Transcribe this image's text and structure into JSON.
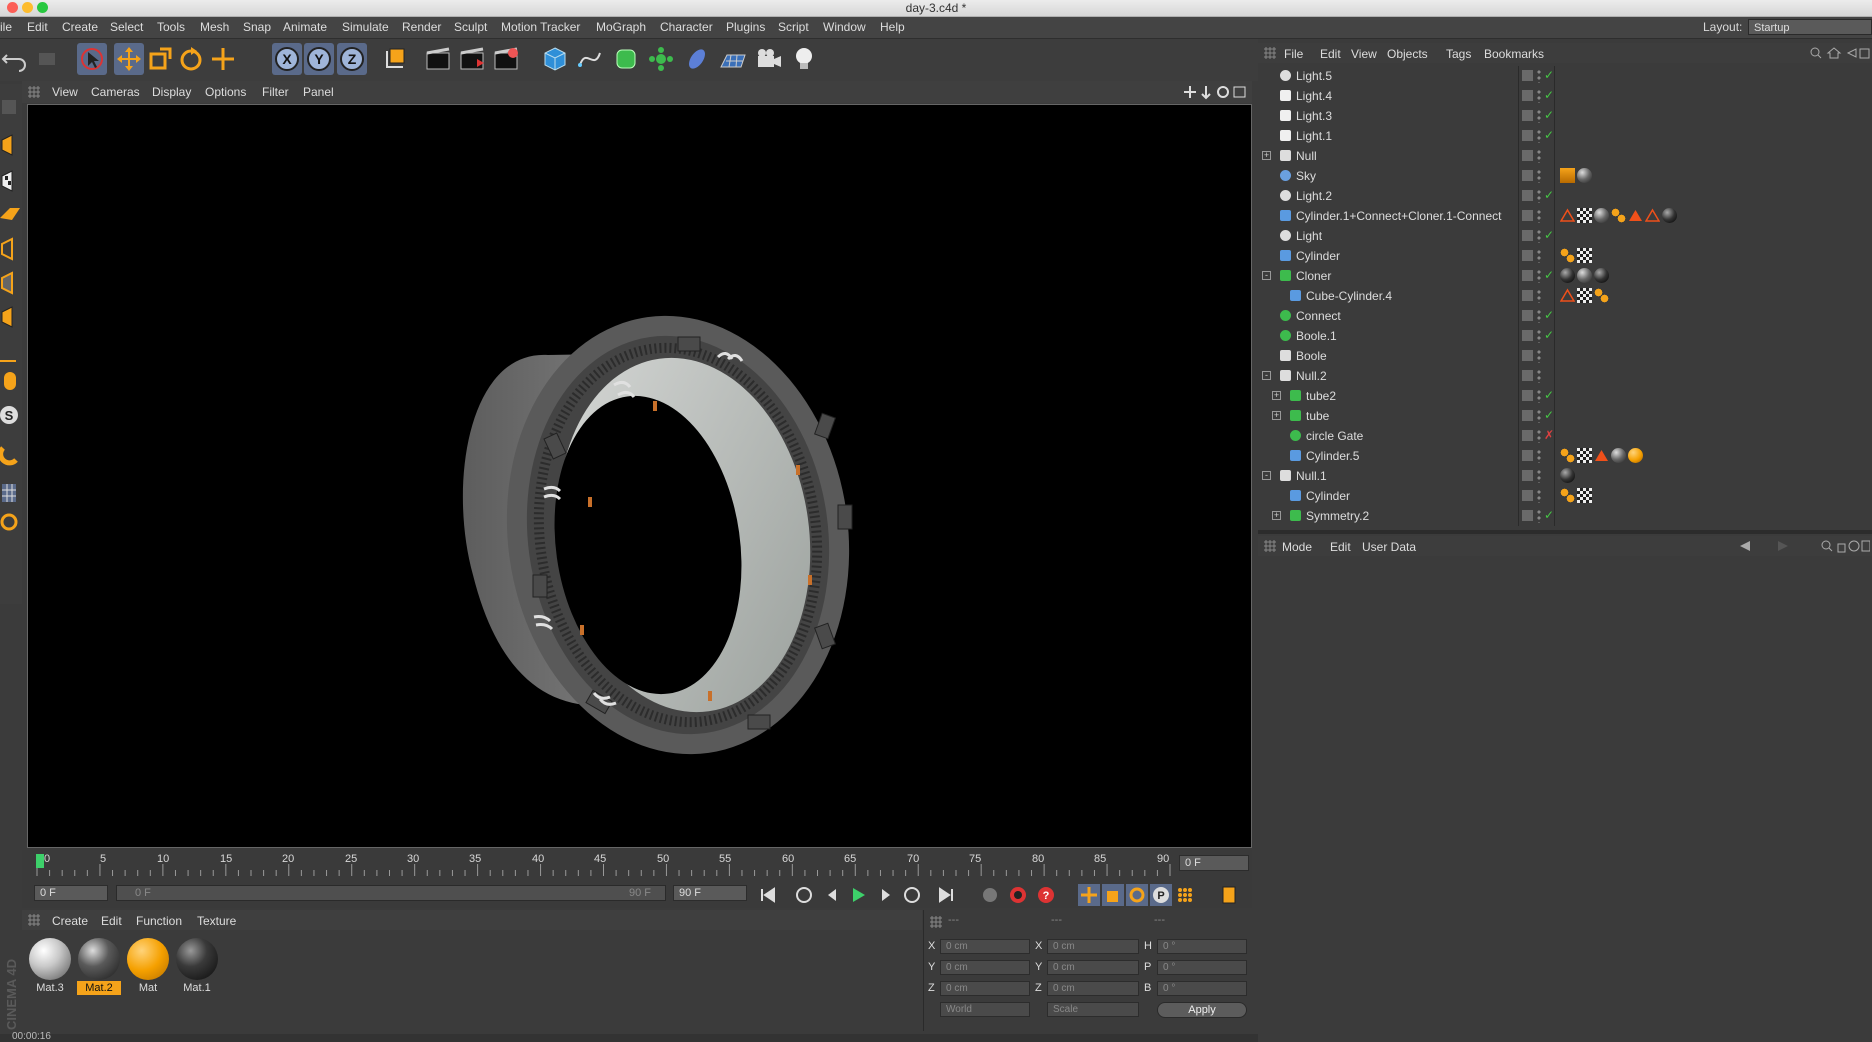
{
  "window": {
    "title": "day-3.c4d *"
  },
  "menubar": {
    "items": [
      "ile",
      "Edit",
      "Create",
      "Select",
      "Tools",
      "Mesh",
      "Snap",
      "Animate",
      "Simulate",
      "Render",
      "Sculpt",
      "Motion Tracker",
      "MoGraph",
      "Character",
      "Plugins",
      "Script",
      "Window",
      "Help"
    ],
    "layout_label": "Layout:",
    "layout_value": "Startup"
  },
  "viewport": {
    "menu": [
      "View",
      "Cameras",
      "Display",
      "Options",
      "Filter",
      "Panel"
    ]
  },
  "timeline": {
    "ticks": [
      "0",
      "5",
      "10",
      "15",
      "20",
      "25",
      "30",
      "35",
      "40",
      "45",
      "50",
      "55",
      "60",
      "65",
      "70",
      "75",
      "80",
      "85",
      "90"
    ],
    "current_frame_field": "0 F",
    "start_field": "0 F",
    "range_start": "0 F",
    "range_end": "90 F",
    "end_field": "90 F"
  },
  "materials": {
    "menu": [
      "Create",
      "Edit",
      "Function",
      "Texture"
    ],
    "items": [
      {
        "name": "Mat.3",
        "color": "#c9c9c9",
        "selected": false
      },
      {
        "name": "Mat.2",
        "color": "#5a5a5a",
        "selected": true
      },
      {
        "name": "Mat",
        "color": "#f5a000",
        "selected": false
      },
      {
        "name": "Mat.1",
        "color": "#3a3a3a",
        "selected": false
      }
    ]
  },
  "coordinates": {
    "headers": [
      "---",
      "---",
      "---"
    ],
    "rows": [
      {
        "a": "X",
        "av": "0 cm",
        "b": "X",
        "bv": "0 cm",
        "c": "H",
        "cv": "0 °"
      },
      {
        "a": "Y",
        "av": "0 cm",
        "b": "Y",
        "bv": "0 cm",
        "c": "P",
        "cv": "0 °"
      },
      {
        "a": "Z",
        "av": "0 cm",
        "b": "Z",
        "bv": "0 cm",
        "c": "B",
        "cv": "0 °"
      }
    ],
    "mode": "World",
    "scale": "Scale",
    "apply": "Apply"
  },
  "object_manager": {
    "menu": [
      "File",
      "Edit",
      "View",
      "Objects",
      "Tags",
      "Bookmarks"
    ],
    "objects": [
      {
        "name": "Light.5",
        "icon": "light",
        "indent": 0,
        "check": "✓",
        "tags": []
      },
      {
        "name": "Light.4",
        "icon": "arealight",
        "indent": 0,
        "check": "✓",
        "tags": []
      },
      {
        "name": "Light.3",
        "icon": "arealight",
        "indent": 0,
        "check": "✓",
        "tags": []
      },
      {
        "name": "Light.1",
        "icon": "arealight",
        "indent": 0,
        "check": "✓",
        "tags": []
      },
      {
        "name": "Null",
        "icon": "null",
        "indent": 0,
        "check": "",
        "expand": "+",
        "tags": []
      },
      {
        "name": "Sky",
        "icon": "sky",
        "indent": 0,
        "check": "",
        "tags": [
          "compositing",
          "material-grey"
        ]
      },
      {
        "name": "Light.2",
        "icon": "light",
        "indent": 0,
        "check": "✓",
        "tags": []
      },
      {
        "name": "Cylinder.1+Connect+Cloner.1-Connect",
        "icon": "poly",
        "indent": 0,
        "check": "",
        "tags": [
          "phong",
          "checker",
          "material-grey",
          "dots",
          "triangle",
          "phong",
          "material-dark"
        ]
      },
      {
        "name": "Light",
        "icon": "light",
        "indent": 0,
        "check": "✓",
        "tags": []
      },
      {
        "name": "Cylinder",
        "icon": "poly",
        "indent": 0,
        "check": "",
        "tags": [
          "dots",
          "checker"
        ]
      },
      {
        "name": "Cloner",
        "icon": "cloner",
        "indent": 0,
        "check": "✓",
        "expand": "-",
        "tags": [
          "material-dark",
          "material-grey",
          "material-dark"
        ]
      },
      {
        "name": "Cube-Cylinder.4",
        "icon": "poly",
        "indent": 1,
        "check": "",
        "tags": [
          "phong",
          "checker",
          "dots"
        ]
      },
      {
        "name": "Connect",
        "icon": "connect",
        "indent": 0,
        "check": "✓",
        "tags": []
      },
      {
        "name": "Boole.1",
        "icon": "boole",
        "indent": 0,
        "check": "✓",
        "tags": []
      },
      {
        "name": "Boole",
        "icon": "null",
        "indent": 0,
        "check": "",
        "tags": []
      },
      {
        "name": "Null.2",
        "icon": "null",
        "indent": 0,
        "check": "",
        "expand": "-",
        "tags": []
      },
      {
        "name": "tube2",
        "icon": "cloner",
        "indent": 1,
        "check": "✓",
        "expand": "+",
        "tags": []
      },
      {
        "name": "tube",
        "icon": "cloner",
        "indent": 1,
        "check": "✓",
        "expand": "+",
        "tags": []
      },
      {
        "name": "circle Gate",
        "icon": "boole",
        "indent": 1,
        "check": "✗",
        "tags": []
      },
      {
        "name": "Cylinder.5",
        "icon": "poly",
        "indent": 1,
        "check": "",
        "tags": [
          "dots",
          "checker",
          "triangle",
          "material-grey",
          "material-orange"
        ]
      },
      {
        "name": "Null.1",
        "icon": "null",
        "indent": 0,
        "check": "",
        "expand": "-",
        "tags": [
          "material-dark"
        ]
      },
      {
        "name": "Cylinder",
        "icon": "poly",
        "indent": 1,
        "check": "",
        "tags": [
          "dots",
          "checker"
        ]
      },
      {
        "name": "Symmetry.2",
        "icon": "symmetry",
        "indent": 1,
        "check": "✓",
        "expand": "+",
        "tags": []
      }
    ]
  },
  "attributes": {
    "menu": [
      "Mode",
      "Edit",
      "User Data"
    ]
  },
  "status": {
    "time": "00:00:16"
  },
  "logo": {
    "text": "CINEMA 4D"
  },
  "colors": {
    "accent_orange": "#f5a31a",
    "check_green": "#46c846",
    "cross_red": "#e04040",
    "selection_blue": "#5a6a8a"
  }
}
